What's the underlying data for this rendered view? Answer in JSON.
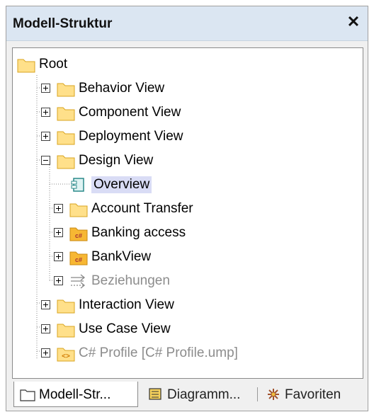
{
  "panel": {
    "title": "Modell-Struktur",
    "close_symbol": "✕"
  },
  "tree": [
    {
      "label": "Root",
      "icon": "folder-icon",
      "expander": "none",
      "level": 0
    },
    {
      "label": "Behavior View",
      "icon": "folder-icon",
      "expander": "plus",
      "level": 1
    },
    {
      "label": "Component View",
      "icon": "folder-icon",
      "expander": "plus",
      "level": 1
    },
    {
      "label": "Deployment View",
      "icon": "folder-icon",
      "expander": "plus",
      "level": 1
    },
    {
      "label": "Design View",
      "icon": "folder-icon",
      "expander": "minus",
      "level": 1
    },
    {
      "label": "Overview",
      "icon": "diagram-icon",
      "expander": "none",
      "level": 2,
      "selected": true
    },
    {
      "label": "Account Transfer",
      "icon": "folder-icon",
      "expander": "plus",
      "level": 2
    },
    {
      "label": "Banking access",
      "icon": "csharp-namespace-icon",
      "expander": "plus",
      "level": 2
    },
    {
      "label": "BankView",
      "icon": "csharp-namespace-icon",
      "expander": "plus",
      "level": 2
    },
    {
      "label": "Beziehungen",
      "icon": "relations-icon",
      "expander": "plus",
      "level": 2,
      "grayed": true
    },
    {
      "label": "Interaction View",
      "icon": "folder-icon",
      "expander": "plus",
      "level": 1
    },
    {
      "label": "Use Case View",
      "icon": "folder-icon",
      "expander": "plus",
      "level": 1
    },
    {
      "label": "C# Profile [C# Profile.ump]",
      "icon": "profile-icon",
      "expander": "plus",
      "level": 1,
      "grayed": true
    }
  ],
  "tabs": [
    {
      "label": "Modell-Str...",
      "icon": "folder-outline-icon",
      "active": true
    },
    {
      "label": "Diagramm...",
      "icon": "diagram-tree-icon",
      "active": false
    },
    {
      "label": "Favoriten",
      "icon": "favorites-icon",
      "active": false
    }
  ],
  "colors": {
    "titlebar": "#dbe6f2",
    "selection": "#d9dcf5",
    "folder_fill": "#ffe08a",
    "csharp_fill": "#f7b733",
    "grayed_text": "#8c8c8c"
  }
}
